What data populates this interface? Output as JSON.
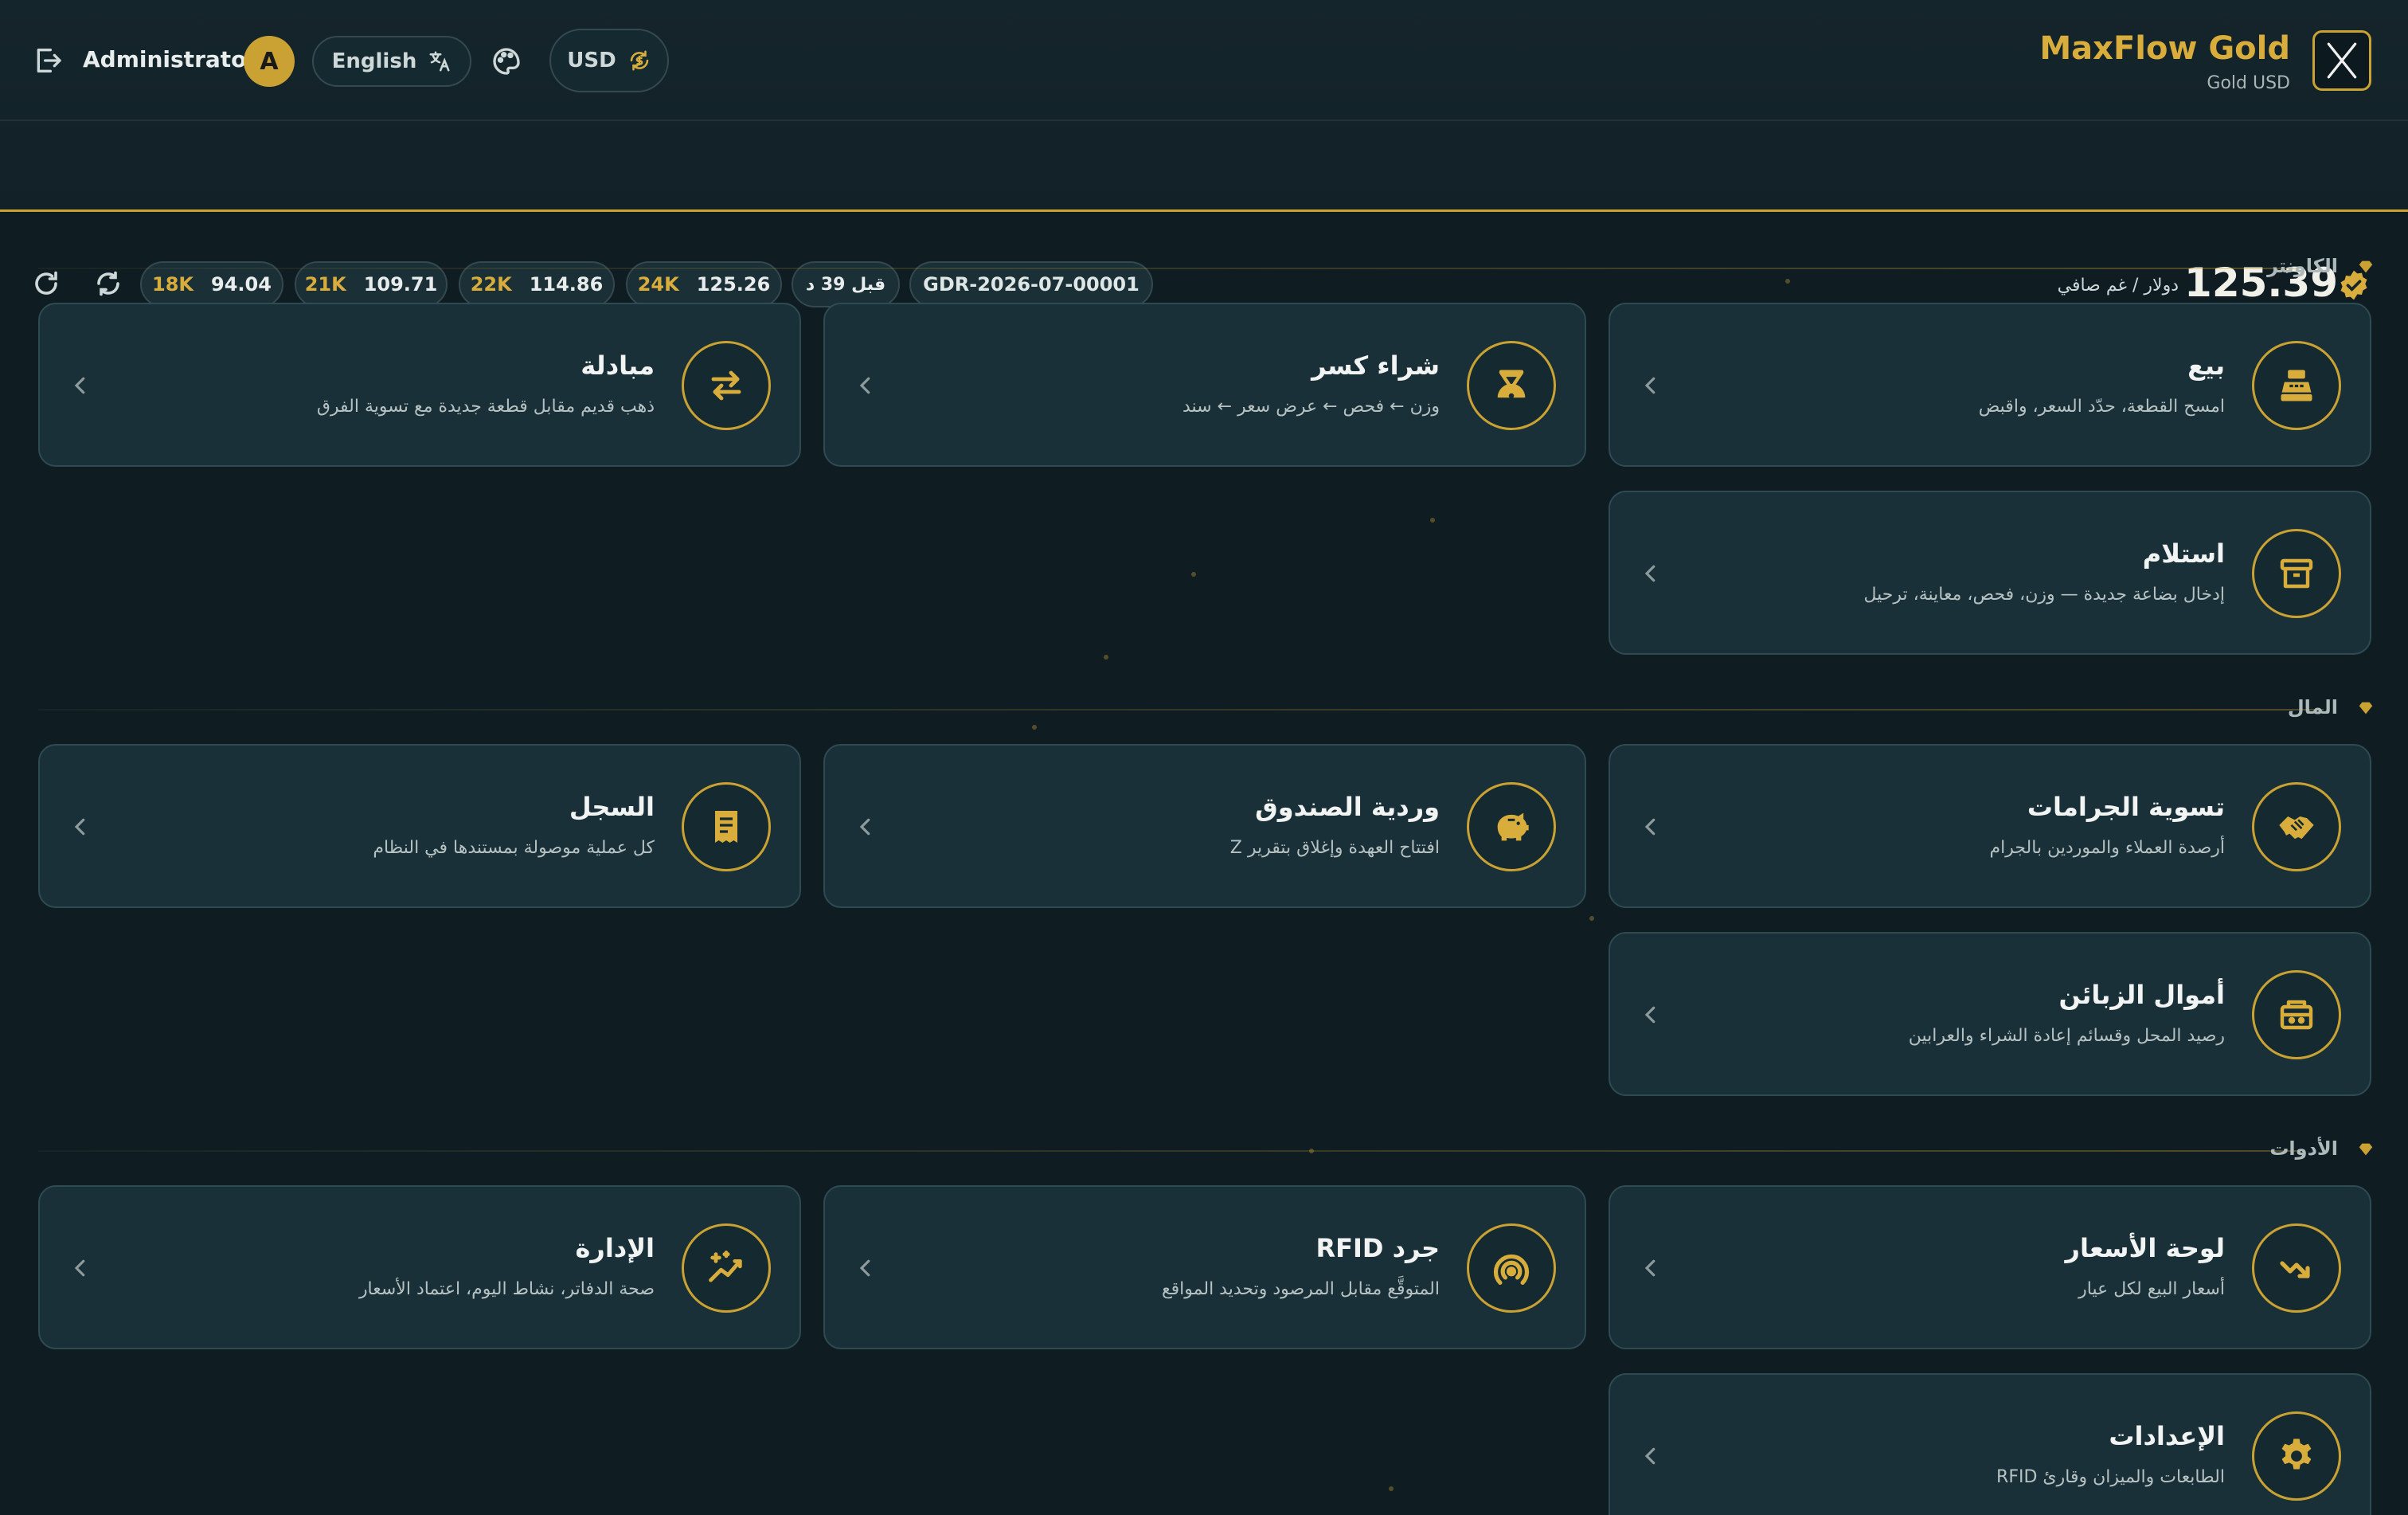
{
  "header": {
    "user_label": "Administrator",
    "avatar_letter": "A",
    "language_label": "English",
    "currency_label": "USD",
    "brand_name": "MaxFlow Gold",
    "brand_sub": "Gold USD",
    "price_value": "125.39",
    "price_unit": "دولار / غم صافي",
    "karats": [
      {
        "k": "18K",
        "v": "94.04"
      },
      {
        "k": "21K",
        "v": "109.71"
      },
      {
        "k": "22K",
        "v": "114.86"
      },
      {
        "k": "24K",
        "v": "125.26"
      }
    ],
    "since_label": "قبل 39 د",
    "doc_id": "GDR-2026-07-00001"
  },
  "sections": [
    {
      "title": "الكاونتر",
      "cards": [
        {
          "title": "بيع",
          "desc": "امسح القطعة، حدّد السعر، واقبض",
          "icon": "register-icon"
        },
        {
          "title": "شراء كسر",
          "desc": "وزن ← فحص ← عرض سعر ← سند",
          "icon": "scale-icon"
        },
        {
          "title": "مبادلة",
          "desc": "ذهب قديم مقابل قطعة جديدة مع تسوية الفرق",
          "icon": "swap-icon"
        },
        {
          "title": "استلام",
          "desc": "إدخال بضاعة جديدة — وزن، فحص، معاينة، ترحيل",
          "icon": "archive-icon"
        }
      ]
    },
    {
      "title": "المال",
      "cards": [
        {
          "title": "تسوية الجرامات",
          "desc": "أرصدة العملاء والموردين بالجرام",
          "icon": "handshake-icon"
        },
        {
          "title": "وردية الصندوق",
          "desc": "افتتاح العهدة وإغلاق بتقرير Z",
          "icon": "piggy-bank-icon"
        },
        {
          "title": "السجل",
          "desc": "كل عملية موصولة بمستندها في النظام",
          "icon": "receipt-icon"
        },
        {
          "title": "أموال الزبائن",
          "desc": "رصيد المحل وقسائم إعادة الشراء والعرابين",
          "icon": "wallet-icon"
        }
      ]
    },
    {
      "title": "الأدوات",
      "cards": [
        {
          "title": "لوحة الأسعار",
          "desc": "أسعار البيع لكل عيار",
          "icon": "trend-icon"
        },
        {
          "title": "جرد RFID",
          "desc": "المتوقَّع مقابل المرصود وتحديد المواقع",
          "icon": "rfid-icon"
        },
        {
          "title": "الإدارة",
          "desc": "صحة الدفاتر، نشاط اليوم، اعتماد الأسعار",
          "icon": "sparkle-chart-icon"
        },
        {
          "title": "الإعدادات",
          "desc": "الطابعات والميزان وقارئ RFID",
          "icon": "gear-icon"
        }
      ]
    }
  ],
  "colors": {
    "accent": "#c9a233",
    "background": "#0f1d23",
    "card": "#193038"
  }
}
